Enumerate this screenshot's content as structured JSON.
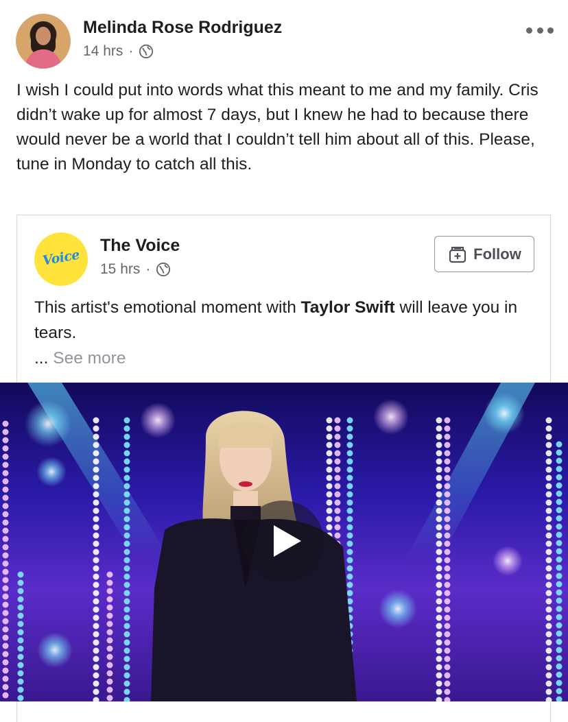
{
  "post": {
    "author_name": "Melinda Rose Rodriguez",
    "timestamp": "14 hrs",
    "separator": "·",
    "privacy_icon": "globe-icon",
    "more_icon": "more-options-icon",
    "text": "I wish I could put into words what this meant to me and my family. Cris didn’t wake up for almost 7 days, but I knew he had to because there would never be a world that I couldn’t tell him about all of this. Please, tune in Monday to catch all this."
  },
  "shared": {
    "page_name": "The Voice",
    "logo_text": "Voice",
    "timestamp": "15 hrs",
    "separator": "·",
    "privacy_icon": "globe-icon",
    "follow_label": "Follow",
    "follow_icon": "follow-page-icon",
    "text_before": "This artist's emotional moment with ",
    "text_bold": "Taylor Swift",
    "text_after": " will leave you in tears.",
    "ellipsis": "...",
    "see_more": "See more"
  },
  "video": {
    "play_icon": "play-icon",
    "colors": {
      "background": "#2a1aa8",
      "light_pink": "#f5c8ff",
      "light_cyan": "#7fe9ff",
      "jacket": "#1a1428"
    }
  }
}
